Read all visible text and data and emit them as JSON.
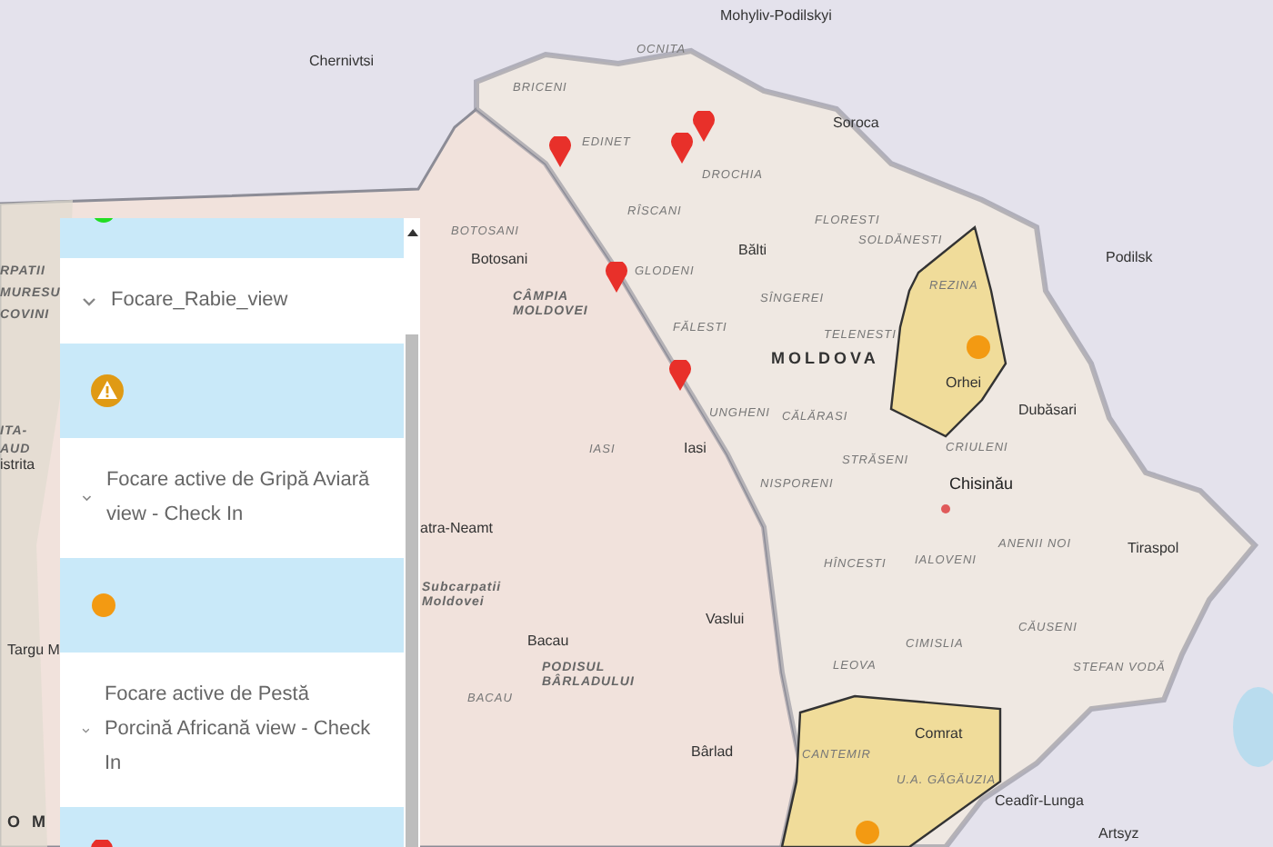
{
  "map": {
    "labels": [
      {
        "text": "Chernivtsi",
        "kind": "city"
      },
      {
        "text": "Mohyliv-Podilskyi",
        "kind": "city"
      },
      {
        "text": "OCNITA",
        "kind": "district"
      },
      {
        "text": "BRICENI",
        "kind": "district"
      },
      {
        "text": "EDINET",
        "kind": "district"
      },
      {
        "text": "Soroca",
        "kind": "city"
      },
      {
        "text": "DROCHIA",
        "kind": "district"
      },
      {
        "text": "RÎSCANI",
        "kind": "district"
      },
      {
        "text": "FLORESTI",
        "kind": "district"
      },
      {
        "text": "SOLDĂNESTI",
        "kind": "district"
      },
      {
        "text": "Bălti",
        "kind": "city"
      },
      {
        "text": "Podilsk",
        "kind": "city"
      },
      {
        "text": "GLODENI",
        "kind": "district"
      },
      {
        "text": "REZINA",
        "kind": "district"
      },
      {
        "text": "SÎNGEREI",
        "kind": "district"
      },
      {
        "text": "FĂLESTI",
        "kind": "district"
      },
      {
        "text": "TELENESTI",
        "kind": "district"
      },
      {
        "text": "MOLDOVA",
        "kind": "country"
      },
      {
        "text": "Orhei",
        "kind": "city"
      },
      {
        "text": "UNGHENI",
        "kind": "district"
      },
      {
        "text": "CĂLĂRASI",
        "kind": "district"
      },
      {
        "text": "Dubăsari",
        "kind": "city"
      },
      {
        "text": "CRIULENI",
        "kind": "district"
      },
      {
        "text": "STRĂSENI",
        "kind": "district"
      },
      {
        "text": "NISPORENI",
        "kind": "district"
      },
      {
        "text": "Chisinău",
        "kind": "capital"
      },
      {
        "text": "ANENII NOI",
        "kind": "district"
      },
      {
        "text": "IALOVENI",
        "kind": "district"
      },
      {
        "text": "HÎNCESTI",
        "kind": "district"
      },
      {
        "text": "Tiraspol",
        "kind": "city"
      },
      {
        "text": "CĂUSENI",
        "kind": "district"
      },
      {
        "text": "CIMISLIA",
        "kind": "district"
      },
      {
        "text": "LEOVA",
        "kind": "district"
      },
      {
        "text": "STEFAN VODĂ",
        "kind": "district"
      },
      {
        "text": "CANTEMIR",
        "kind": "district"
      },
      {
        "text": "Comrat",
        "kind": "city"
      },
      {
        "text": "U.A. GĂGĂUZIA",
        "kind": "district"
      },
      {
        "text": "Ceadîr-Lunga",
        "kind": "city"
      },
      {
        "text": "Artsyz",
        "kind": "city"
      },
      {
        "text": "BOTOSANI",
        "kind": "district"
      },
      {
        "text": "Botosani",
        "kind": "city"
      },
      {
        "text": "CÂMPIA MOLDOVEI",
        "kind": "region"
      },
      {
        "text": "IASI",
        "kind": "district"
      },
      {
        "text": "Iasi",
        "kind": "city"
      },
      {
        "text": "atra-Neamt",
        "kind": "city"
      },
      {
        "text": "Subcarpatii Moldovei",
        "kind": "region"
      },
      {
        "text": "Bacau",
        "kind": "city"
      },
      {
        "text": "Vaslui",
        "kind": "city"
      },
      {
        "text": "BACAU",
        "kind": "district"
      },
      {
        "text": "PODISUL BÂRLADULUI",
        "kind": "region"
      },
      {
        "text": "Bârlad",
        "kind": "city"
      },
      {
        "text": "RPATII",
        "kind": "region"
      },
      {
        "text": "MURESU",
        "kind": "region"
      },
      {
        "text": "COVINI",
        "kind": "region"
      },
      {
        "text": "ITA-",
        "kind": "region"
      },
      {
        "text": "AUD",
        "kind": "region"
      },
      {
        "text": "istrita",
        "kind": "city"
      },
      {
        "text": "Targu M",
        "kind": "city"
      },
      {
        "text": "O M",
        "kind": "country"
      }
    ],
    "markers": [
      {
        "kind": "pin"
      },
      {
        "kind": "pin"
      },
      {
        "kind": "pin"
      },
      {
        "kind": "pin"
      },
      {
        "kind": "pin"
      },
      {
        "kind": "dot"
      },
      {
        "kind": "dot"
      }
    ]
  },
  "legend": {
    "entries": [
      {
        "kind": "green-symbol"
      },
      {
        "kind": "header",
        "label": "Focare_Rabie_view"
      },
      {
        "kind": "warning-symbol"
      },
      {
        "kind": "header",
        "label": "Focare active de Gripă Aviară view - Check In"
      },
      {
        "kind": "orange-symbol"
      },
      {
        "kind": "header",
        "label": "Focare active de Pestă Porcină Africană view - Check In"
      },
      {
        "kind": "pin-symbol"
      }
    ]
  }
}
